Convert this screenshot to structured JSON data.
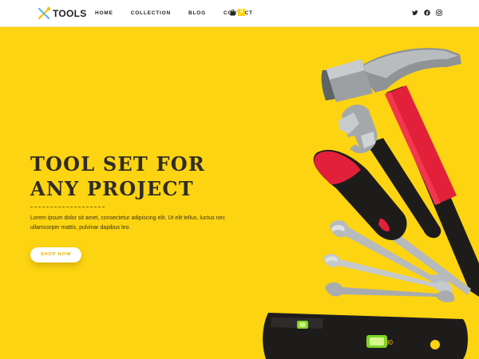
{
  "header": {
    "logo_text": "TOOLS",
    "nav": [
      "HOME",
      "COLLECTION",
      "BLOG",
      "CONTACT"
    ],
    "cart_count": "0",
    "social_icons": [
      "twitter-icon",
      "facebook-icon",
      "instagram-icon"
    ]
  },
  "hero": {
    "title_line1": "TOOL SET FOR",
    "title_line2": "ANY PROJECT",
    "description": "Lorem ipsum dolor sit amet, consectetur adipiscing elit. Ut elit tellus, luctus nec ullamcorper mattis, pulvinar dapibus leo.",
    "button_label": "SHOP NOW",
    "level_marking": "90"
  },
  "colors": {
    "background": "#fdd411",
    "accent": "#fdd411",
    "heading": "#2f2c28",
    "tool_red": "#e2203a",
    "tool_black": "#1e1c1b"
  }
}
